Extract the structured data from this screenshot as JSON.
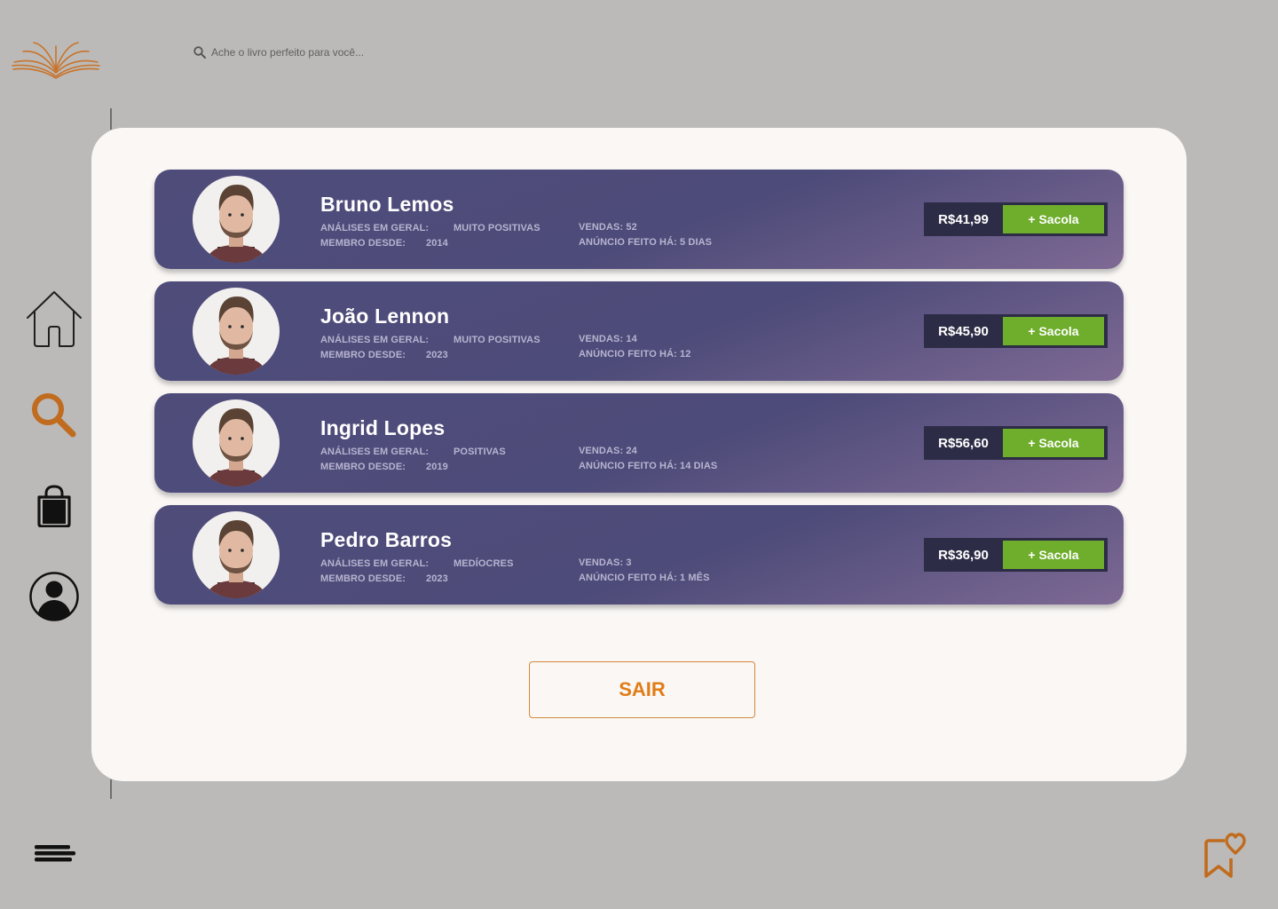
{
  "header": {
    "logo_icon": "open-book-icon",
    "search": {
      "icon": "search-icon",
      "placeholder": "Ache o livro perfeito para você..."
    }
  },
  "sidebar": {
    "items": [
      {
        "name": "home",
        "icon": "home-icon"
      },
      {
        "name": "search",
        "icon": "search-icon",
        "active": true
      },
      {
        "name": "bag",
        "icon": "shopping-bag-icon"
      },
      {
        "name": "profile",
        "icon": "user-circle-icon"
      }
    ],
    "menu_icon": "menu-icon"
  },
  "sellers": [
    {
      "name": "Bruno Lemos",
      "reviews_label": "ANÁLISES EM GERAL:",
      "reviews": "MUITO POSITIVAS",
      "member_label": "MEMBRO DESDE:",
      "member_since": "2014",
      "sales": "VENDAS: 52",
      "listing_age": "ANÚNCIO FEITO HÁ: 5 DIAS",
      "price": "R$41,99",
      "add_label": "+ Sacola"
    },
    {
      "name": "João Lennon",
      "reviews_label": "ANÁLISES EM GERAL:",
      "reviews": "MUITO POSITIVAS",
      "member_label": "MEMBRO DESDE:",
      "member_since": "2023",
      "sales": "VENDAS: 14",
      "listing_age": "ANÚNCIO FEITO HÁ: 12",
      "price": "R$45,90",
      "add_label": "+ Sacola"
    },
    {
      "name": "Ingrid Lopes",
      "reviews_label": "ANÁLISES EM GERAL:",
      "reviews": "POSITIVAS",
      "member_label": "MEMBRO DESDE:",
      "member_since": "2019",
      "sales": "VENDAS: 24",
      "listing_age": "ANÚNCIO FEITO HÁ: 14 DIAS",
      "price": "R$56,60",
      "add_label": "+ Sacola"
    },
    {
      "name": "Pedro Barros",
      "reviews_label": "ANÁLISES EM GERAL:",
      "reviews": "MEDÍOCRES",
      "member_label": "MEMBRO DESDE:",
      "member_since": "2023",
      "sales": "VENDAS: 3",
      "listing_age": "ANÚNCIO FEITO HÁ: 1 MÊS",
      "price": "R$36,90",
      "add_label": "+ Sacola"
    }
  ],
  "exit_label": "SAIR",
  "bookmark_icon": "bookmark-heart-icon",
  "colors": {
    "accent": "#e07d17",
    "card": "#4d4b79",
    "add_button": "#6fad2c",
    "price_box": "#2d2c46",
    "panel": "#faf7f5",
    "background": "#bbbab8"
  }
}
